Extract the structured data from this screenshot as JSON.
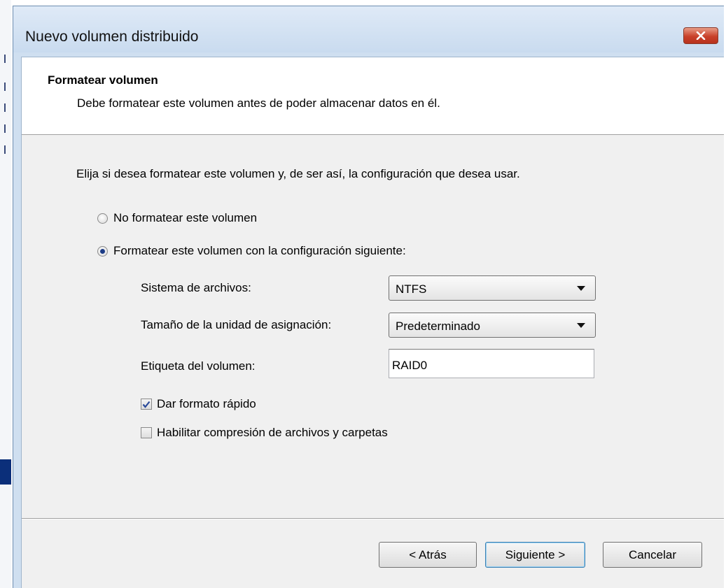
{
  "window": {
    "title": "Nuevo volumen distribuido"
  },
  "header": {
    "title": "Formatear volumen",
    "subtitle": "Debe formatear este volumen antes de poder almacenar datos en él."
  },
  "instruction": "Elija si desea formatear este volumen y, de ser así, la configuración que desea usar.",
  "options": {
    "no_format": {
      "label": "No formatear este volumen",
      "checked": false
    },
    "format": {
      "label": "Formatear este volumen con la configuración siguiente:",
      "checked": true
    }
  },
  "fields": {
    "filesystem": {
      "label": "Sistema de archivos:",
      "value": "NTFS"
    },
    "allocation": {
      "label": "Tamaño de la unidad de asignación:",
      "value": "Predeterminado"
    },
    "volume_label": {
      "label": "Etiqueta del volumen:",
      "value": "RAID0"
    }
  },
  "checkboxes": {
    "quick_format": {
      "label": "Dar formato rápido",
      "checked": true
    },
    "compression": {
      "label": "Habilitar compresión de archivos y carpetas",
      "checked": false
    }
  },
  "buttons": {
    "back": "< Atrás",
    "next": "Siguiente >",
    "cancel": "Cancelar"
  },
  "colors": {
    "title_bar": "#cfdff0",
    "close_button": "#c9412a",
    "radio_dot": "#1c3b86",
    "default_button_border": "#3c7fb1"
  }
}
